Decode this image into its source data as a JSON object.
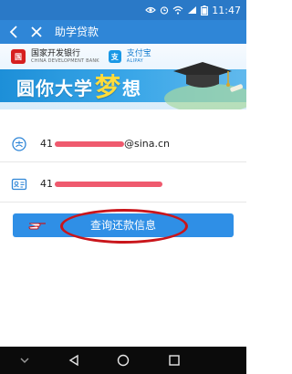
{
  "status_bar": {
    "time": "11:47",
    "icons": [
      "eye-icon",
      "alarm-icon",
      "wifi-icon",
      "signal-icon",
      "battery-icon"
    ]
  },
  "titlebar": {
    "title": "助学贷款"
  },
  "banner": {
    "bank_name": "国家开发银行",
    "bank_name_en": "CHINA DEVELOPMENT BANK",
    "alipay_name": "支付宝",
    "alipay_name_en": "ALIPAY",
    "slogan_part1": "圆你大学",
    "slogan_highlight": "梦",
    "slogan_part2": "想"
  },
  "form": {
    "email_prefix": "41",
    "email_suffix": "@sina.cn",
    "id_prefix": "41",
    "redaction_color": "#ef5a6e"
  },
  "button": {
    "label": "查询还款信息"
  },
  "annotation": {
    "color": "#c9151b"
  },
  "nav": {
    "icons": [
      "collapse-icon",
      "back-icon",
      "home-icon",
      "recents-icon"
    ]
  },
  "colors": {
    "accent": "#2f86d7",
    "status": "#2a79c7",
    "button": "#2f8fe6"
  }
}
